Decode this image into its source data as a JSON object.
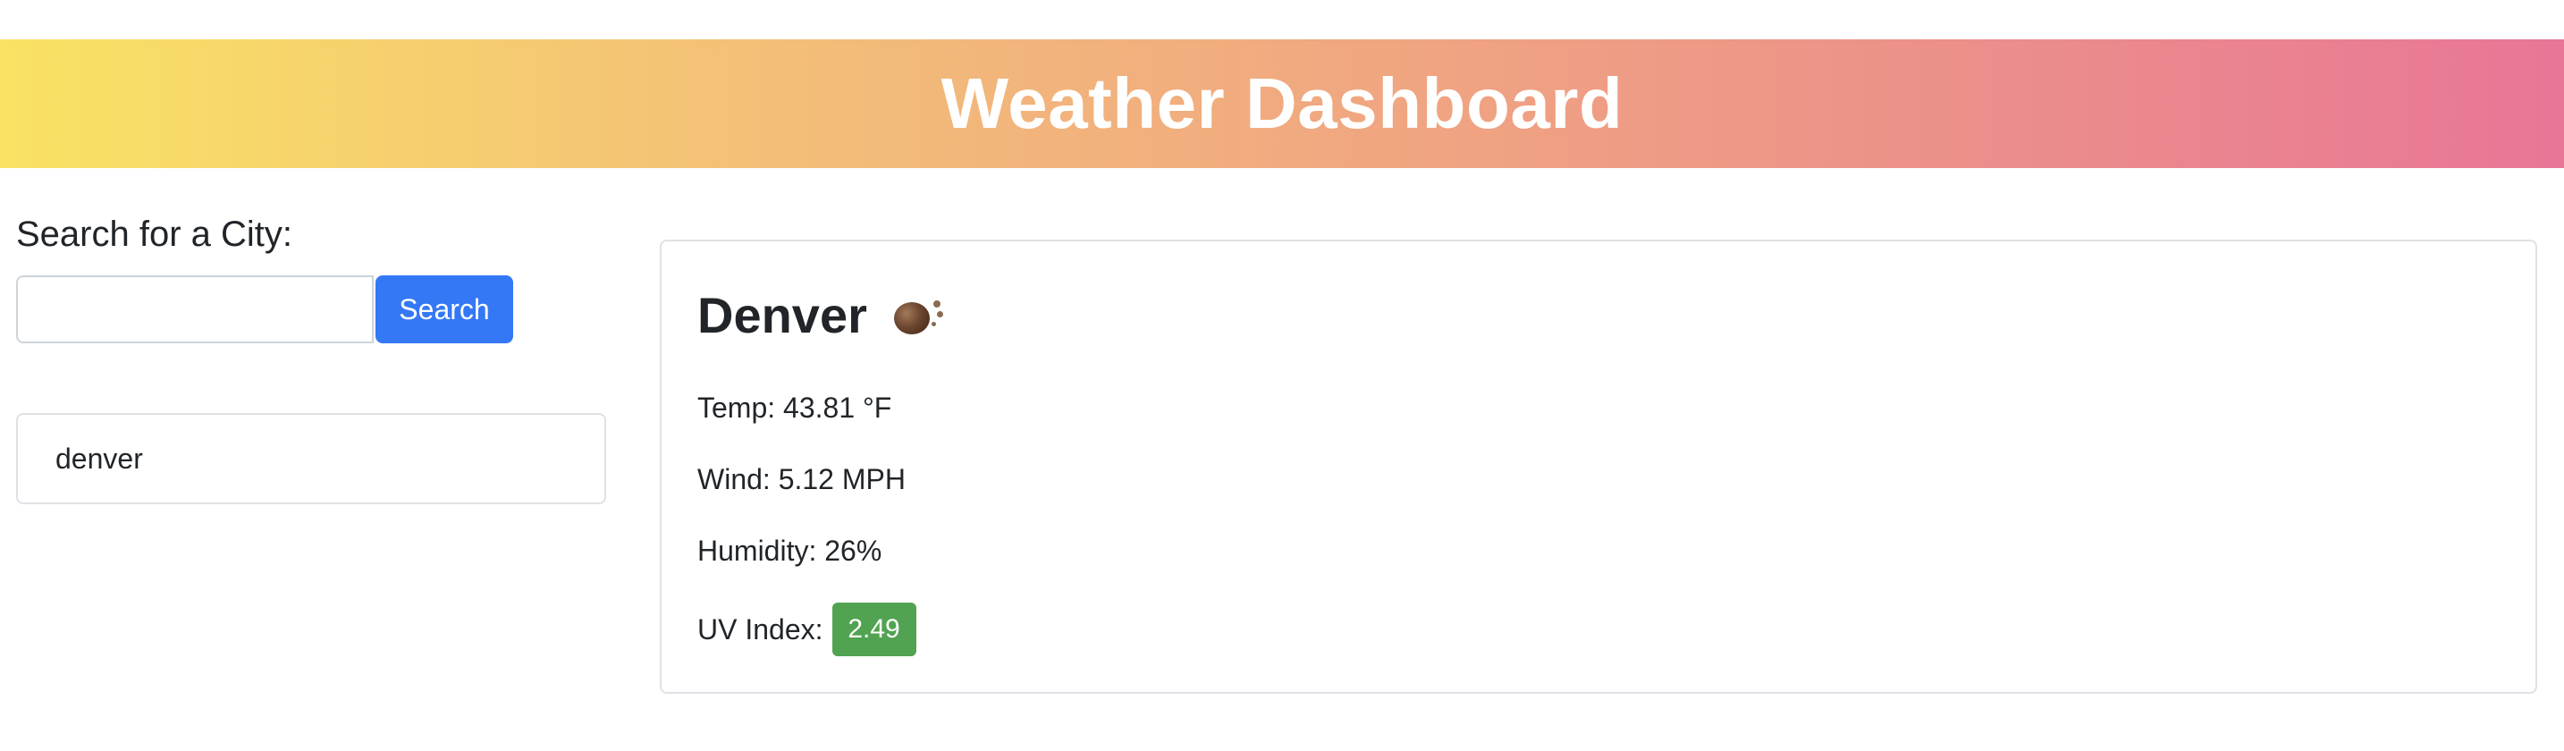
{
  "header": {
    "title": "Weather Dashboard"
  },
  "search": {
    "label": "Search for a City:",
    "input_value": "",
    "placeholder": "",
    "button_label": "Search"
  },
  "history": [
    {
      "city": "denver"
    }
  ],
  "current": {
    "city": "Denver",
    "icon": "weather-condition-icon",
    "temp": "Temp: 43.81 °F",
    "wind": "Wind: 5.12 MPH",
    "humidity": "Humidity: 26%",
    "uv_label": "UV Index:",
    "uv_value": "2.49",
    "uv_color": "#51a351"
  },
  "colors": {
    "accent": "#3478f6",
    "header_gradient_start": "#f9e264",
    "header_gradient_end": "#e87696"
  }
}
